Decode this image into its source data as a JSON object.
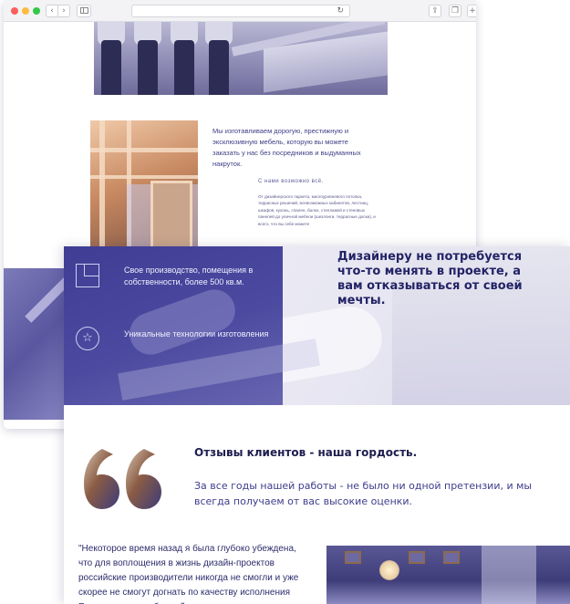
{
  "browser": {
    "back_arrow": "‹",
    "forward_arrow": "›",
    "reload_glyph": "↻",
    "share_glyph": "⇪",
    "tabs_glyph": "❐",
    "new_tab_glyph": "+"
  },
  "intro": {
    "description": "Мы изготавливаем дорогую, престижную и эксклюзивную мебель, которую вы можете заказать у нас без посредников и выдуманных накруток.",
    "tagline": "С нами возможно всё.",
    "list_text": "От дизайнерского паркета, многоуровневого потолка, террасных решений, всевозможных кабинетов, лестниц, шкафов, кухонь, спален, балок, стеллажей и стеновых панелей до уличной мебели (шезлонги, террасные доски), и всего, что вы себе можете"
  },
  "hero": {
    "feature1": "Свое производство, помещения в собственности, более 500 кв.м.",
    "feature2": "Уникальные технологии изготовления",
    "title": "Дизайнеру не потребуется что-то менять в проекте, а вам отказываться от своей мечты.",
    "star_glyph": "☆"
  },
  "reviews": {
    "title": "Отзывы клиентов - наша гордость.",
    "text": "За все годы нашей работы - не было ни одной претензии, и мы всегда получаем от вас высокие оценки.",
    "testimonial": "\"Некоторое время назад я была глубоко убеждена, что для воплощения в жизнь дизайн-проектов российские производители никогда не смогли и уже скорее не смогут догнать по качеству исполнения Европу или даже ближайших наших"
  },
  "colors": {
    "brand_indigo": "#3f3d94",
    "heading_navy": "#232366",
    "body_text": "#3d3d8c"
  },
  "icons": [
    "floor-plan-icon",
    "star-icon",
    "quote-marks-icon",
    "reload-icon",
    "share-icon",
    "tabs-icon",
    "sidebar-icon"
  ]
}
